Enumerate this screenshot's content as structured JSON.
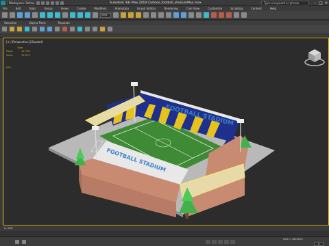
{
  "window": {
    "workspace": "Workspace: Default",
    "title": "Autodesk 3ds Max 2018    Cartoon_football_stadiumMax.max",
    "search_placeholder": "Type a keyword or phrase"
  },
  "menu": [
    "File",
    "Edit",
    "Tools",
    "Group",
    "Views",
    "Create",
    "Modifiers",
    "Animation",
    "Graph Editors",
    "Rendering",
    "Civil View",
    "Customize",
    "Scripting",
    "Content",
    "Help"
  ],
  "toolbar": {
    "view_dropdown": "View"
  },
  "ribbon": [
    "Selection",
    "Object Paint",
    "Populate"
  ],
  "viewport": {
    "label": "[+] [Perspective] [Shaded]",
    "stats_title": "Total",
    "stats": [
      {
        "key": "Polys:",
        "value": "12,798"
      },
      {
        "key": "Verts:",
        "value": "10,373"
      }
    ],
    "fps_label": "FPS:"
  },
  "stadium": {
    "sign_main": "FOOTBALL STADIUM",
    "sign_side": "FOOTBALL STADIUM",
    "colors": {
      "pitch": "#3f8a35",
      "seats_blue": "#1f2f8c",
      "seats_yellow": "#e6c21e",
      "walls": "#c98a72",
      "roof": "#e8d9a8"
    }
  },
  "timeline": {
    "frame": "0 / 100",
    "current_frame": "0"
  },
  "status": {
    "grid": "Grid = 100,0cm"
  },
  "colors": {
    "accent": "#e8c020",
    "viewport_bg": "#2c2c2c"
  }
}
